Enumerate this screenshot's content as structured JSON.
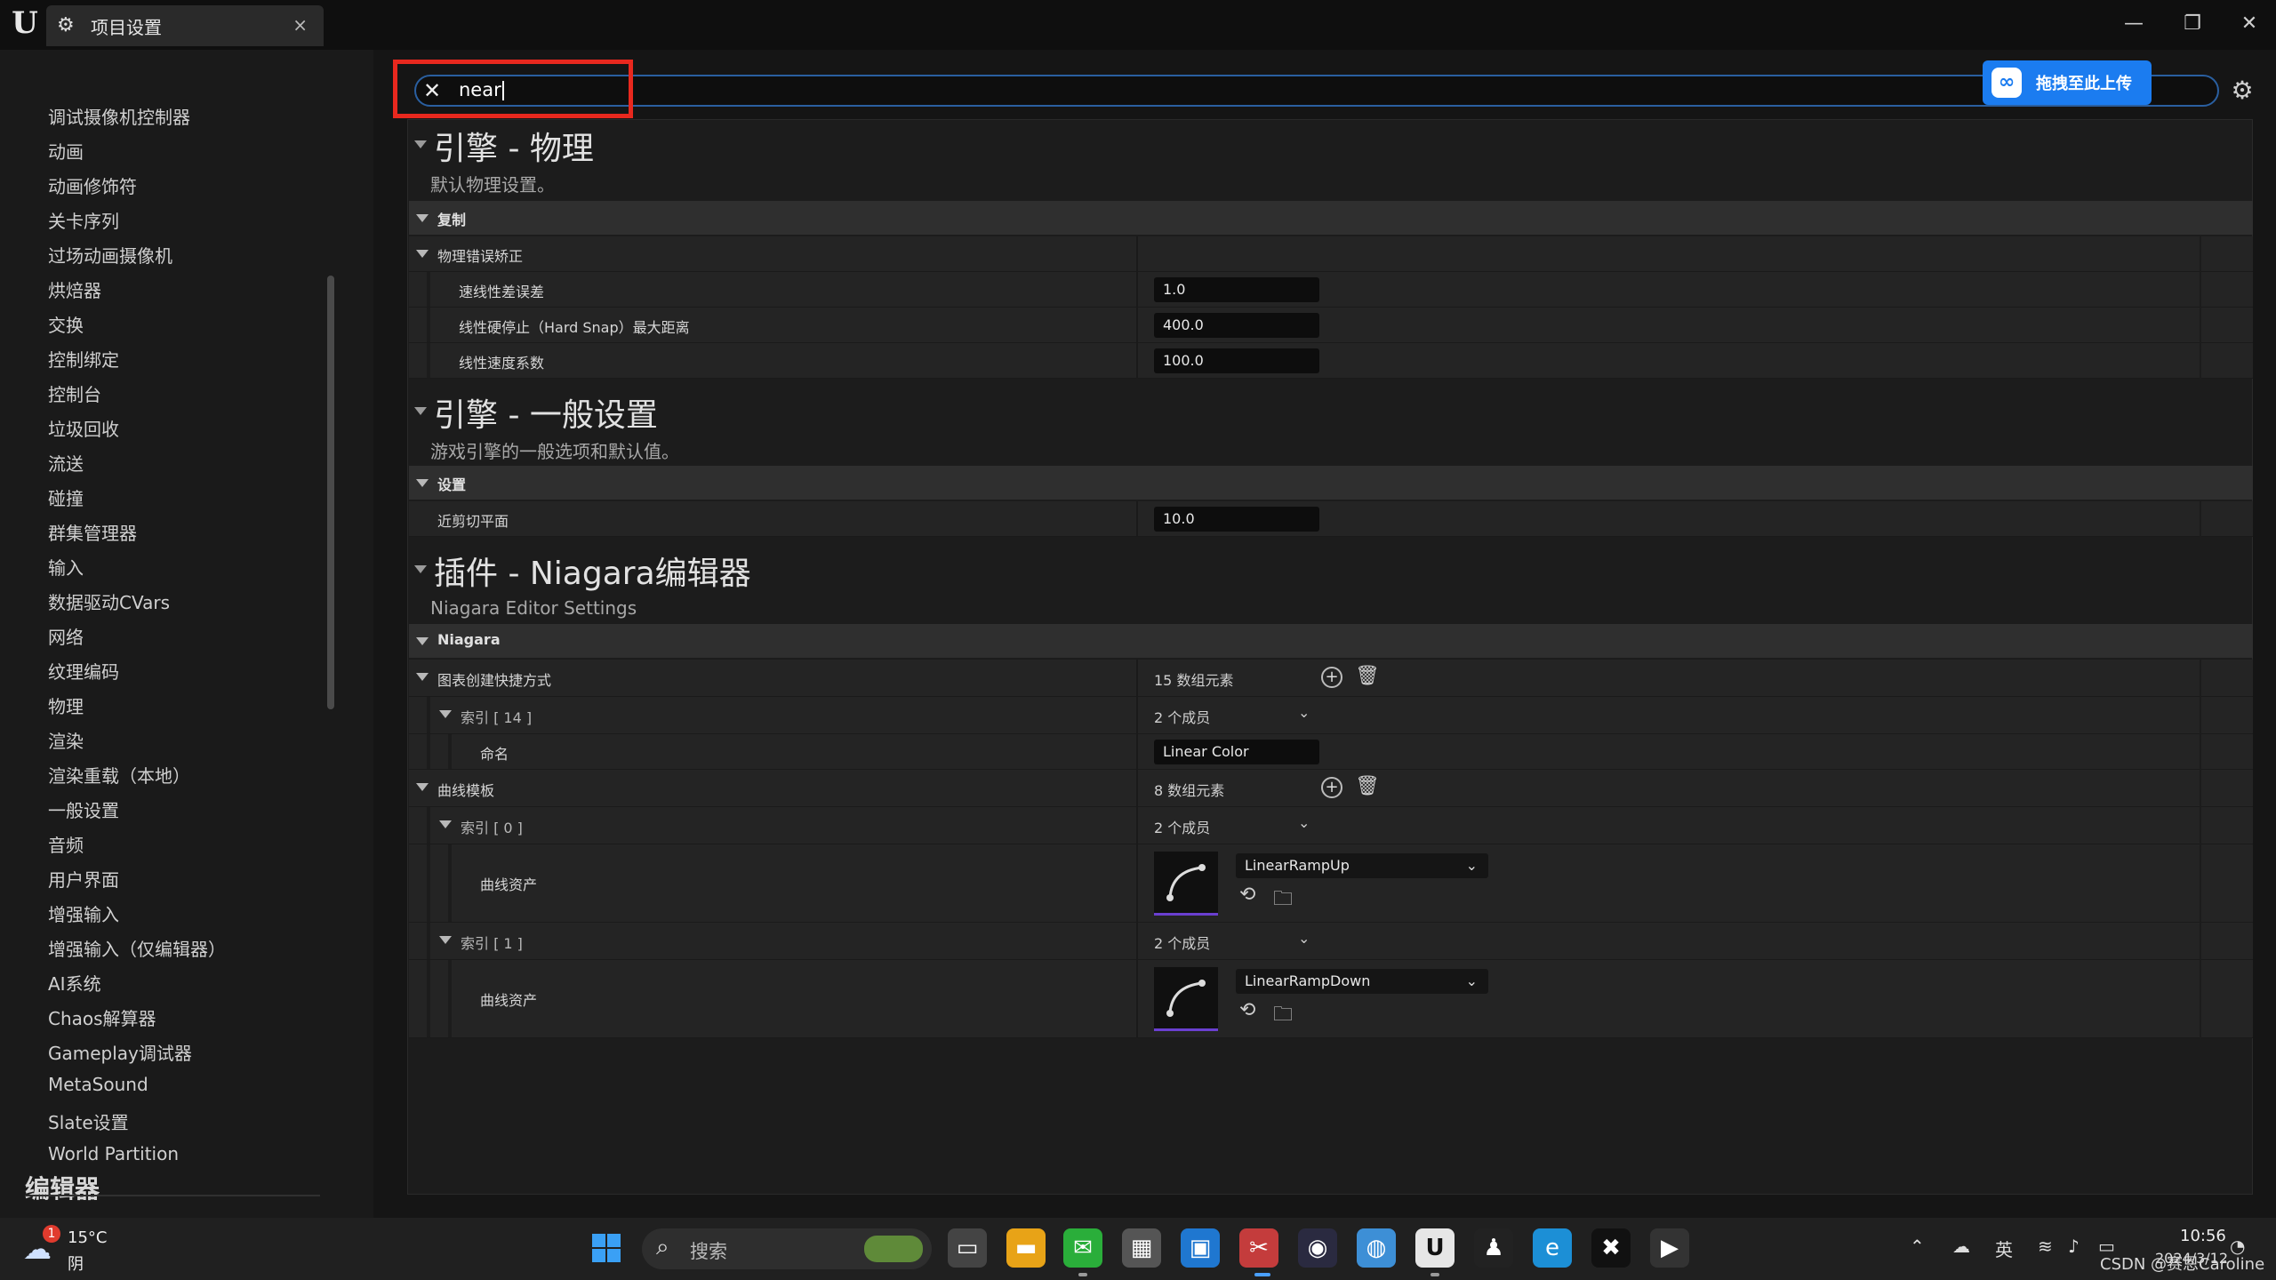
{
  "window": {
    "tab_title": "项目设置",
    "tab_close": "×",
    "minimize": "—",
    "restore": "❐",
    "close": "✕"
  },
  "sidebar": {
    "items": [
      "调试摄像机控制器",
      "动画",
      "动画修饰符",
      "关卡序列",
      "过场动画摄像机",
      "烘焙器",
      "交换",
      "控制绑定",
      "控制台",
      "垃圾回收",
      "流送",
      "碰撞",
      "群集管理器",
      "输入",
      "数据驱动CVars",
      "网络",
      "纹理编码",
      "物理",
      "渲染",
      "渲染重载（本地）",
      "一般设置",
      "音频",
      "用户界面",
      "增强输入",
      "增强输入（仅编辑器）",
      "AI系统",
      "Chaos解算器",
      "Gameplay调试器",
      "MetaSound",
      "Slate设置",
      "World Partition"
    ],
    "section_label": "编辑器"
  },
  "search": {
    "value": "near",
    "clear_icon": "✕"
  },
  "upload": {
    "label": "拖拽至此上传",
    "icon": "∞"
  },
  "sections": {
    "physics": {
      "title": "引擎 - 物理",
      "description": "默认物理设置。",
      "category": "复制",
      "group": "物理错误矫正",
      "props": [
        {
          "name": "速线性差误差",
          "value": "1.0"
        },
        {
          "name": "线性硬停止（Hard Snap）最大距离",
          "value": "400.0"
        },
        {
          "name": "线性速度系数",
          "value": "100.0"
        }
      ]
    },
    "general": {
      "title": "引擎 - 一般设置",
      "description": "游戏引擎的一般选项和默认值。",
      "category": "设置",
      "props": [
        {
          "name": "近剪切平面",
          "value": "10.0"
        }
      ]
    },
    "niagara": {
      "title": "插件 - Niagara编辑器",
      "description": "Niagara Editor Settings",
      "category": "Niagara",
      "graph_shortcuts": {
        "name": "图表创建快捷方式",
        "count": "15 数组元素"
      },
      "index14": {
        "name": "索引 [ 14 ]",
        "members": "2 个成员"
      },
      "naming": {
        "name": "命名",
        "value": "Linear Color"
      },
      "curve_templates": {
        "name": "曲线模板",
        "count": "8 数组元素"
      },
      "index0": {
        "name": "索引 [ 0 ]",
        "members": "2 个成员",
        "asset_label": "曲线资产",
        "asset": "LinearRampUp"
      },
      "index1": {
        "name": "索引 [ 1 ]",
        "members": "2 个成员",
        "asset_label": "曲线资产",
        "asset": "LinearRampDown"
      }
    }
  },
  "taskbar": {
    "weather_temp": "15°C",
    "weather_cond": "阴",
    "weather_badge": "1",
    "search_label": "搜索",
    "tray_lang": "英",
    "time": "10:56",
    "date": "2024/3/12",
    "watermark": "CSDN @赛恩Caroline"
  },
  "colors": {
    "accent_blue": "#1b7cf0",
    "highlight_red": "#e8281e",
    "curve_purple": "#6a3fd0"
  }
}
